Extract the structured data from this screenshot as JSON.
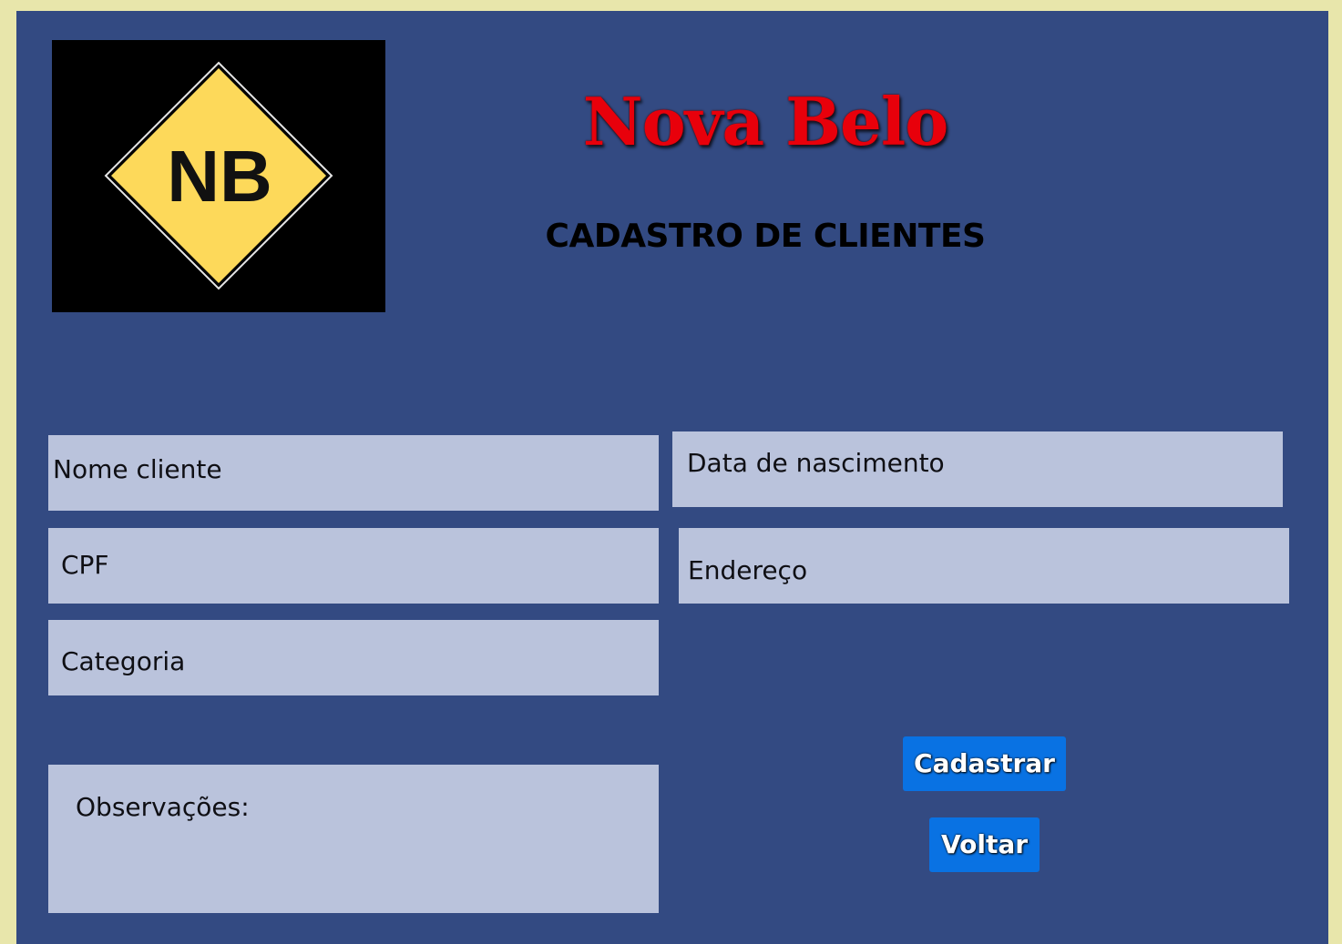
{
  "logo": {
    "text": "NB",
    "icon": "nb-diamond-logo",
    "colors": {
      "background": "#000000",
      "diamond": "#fdd95a",
      "text": "#111111"
    }
  },
  "header": {
    "brand": "Nova Belo",
    "subtitle": "CADASTRO DE CLIENTES"
  },
  "form": {
    "nome_cliente": {
      "label": "Nome cliente"
    },
    "data_nascimento": {
      "label": "Data de nascimento"
    },
    "cpf": {
      "label": "CPF"
    },
    "endereco": {
      "label": "Endereço"
    },
    "categoria": {
      "label": "Categoria"
    },
    "observacoes": {
      "label": "Observações:"
    }
  },
  "actions": {
    "cadastrar": "Cadastrar",
    "voltar": "Voltar"
  },
  "colors": {
    "page_background": "#e8e6ab",
    "panel": "#334a82",
    "field": "#bac3dc",
    "brand_title": "#e8000b",
    "button": "#0972e3"
  }
}
